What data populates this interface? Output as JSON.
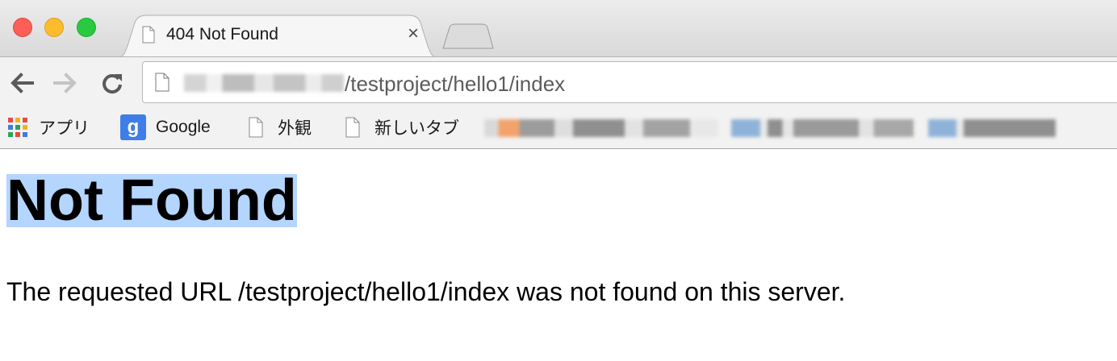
{
  "window": {
    "tab": {
      "title": "404 Not Found",
      "close_glyph": "×"
    }
  },
  "toolbar": {
    "back_icon": "arrow-left-icon",
    "forward_icon": "arrow-right-icon",
    "reload_icon": "reload-icon",
    "address": {
      "path": "/testproject/hello1/index"
    }
  },
  "bookmarks": {
    "items": [
      {
        "label": "アプリ",
        "icon": "apps-grid-icon"
      },
      {
        "label": "Google",
        "icon": "google-icon",
        "icon_text": "g"
      },
      {
        "label": "外観",
        "icon": "page-icon"
      },
      {
        "label": "新しいタブ",
        "icon": "page-icon"
      }
    ]
  },
  "page": {
    "heading": "Not Found",
    "message": "The requested URL /testproject/hello1/index was not found on this server."
  },
  "colors": {
    "selection_highlight": "#b4d5fe",
    "close": "#fc5f57",
    "minimize": "#fdbc2e",
    "maximize": "#29c940",
    "google_icon_bg": "#3f7ee8"
  }
}
